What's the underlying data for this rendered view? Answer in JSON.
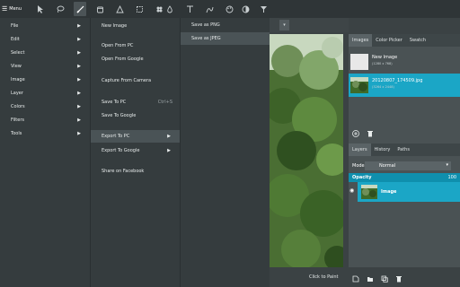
{
  "toolbar": {
    "menu_label": "Menu",
    "tools": [
      {
        "icon": "pointer-icon"
      },
      {
        "icon": "lasso-icon"
      },
      {
        "icon": "brush-icon"
      },
      {
        "icon": "bucket-icon"
      },
      {
        "icon": "triangle-icon"
      },
      {
        "icon": "crop-icon"
      },
      {
        "icon": "clone-stamp-icon"
      },
      {
        "icon": "drop-icon"
      },
      {
        "icon": "text-icon"
      },
      {
        "icon": "curve-icon"
      },
      {
        "icon": "palette-icon"
      },
      {
        "icon": "contrast-icon"
      },
      {
        "icon": "filter-icon"
      }
    ],
    "active_tool": "brush-icon"
  },
  "main_menu": [
    {
      "label": "File"
    },
    {
      "label": "Edit"
    },
    {
      "label": "Select"
    },
    {
      "label": "View"
    },
    {
      "label": "Image"
    },
    {
      "label": "Layer"
    },
    {
      "label": "Colors"
    },
    {
      "label": "Filters"
    },
    {
      "label": "Tools"
    }
  ],
  "file_menu": {
    "new_image": "New Image",
    "open_pc": "Open From PC",
    "open_google": "Open From Google",
    "capture_camera": "Capture From Camera",
    "save_pc": "Save To PC",
    "save_pc_shortcut": "Ctrl+S",
    "save_google": "Save To Google",
    "export_pc": "Export To PC",
    "export_google": "Export To Google",
    "share_facebook": "Share on Facebook"
  },
  "export_menu": {
    "png": "Save as PNG",
    "jpeg": "Save as JPEG"
  },
  "canvas": {
    "dropdown_glyph": "▾",
    "click_to_paint": "Click to Paint"
  },
  "images_panel": {
    "tabs": [
      "Images",
      "Color Picker",
      "Swatch"
    ],
    "new_image_label": "New Image",
    "new_image_size": "(1280 x 768)",
    "image_name": "20120807_174509.jpg",
    "image_size": "(3264 x 2448)"
  },
  "layers_panel": {
    "tabs": [
      "Layers",
      "History",
      "Paths"
    ],
    "mode_label": "Mode",
    "mode_value": "Normal",
    "opacity_label": "Opacity",
    "opacity_value": "100",
    "layer_name": "Image"
  },
  "colors": {
    "accent": "#1ba6c6"
  }
}
